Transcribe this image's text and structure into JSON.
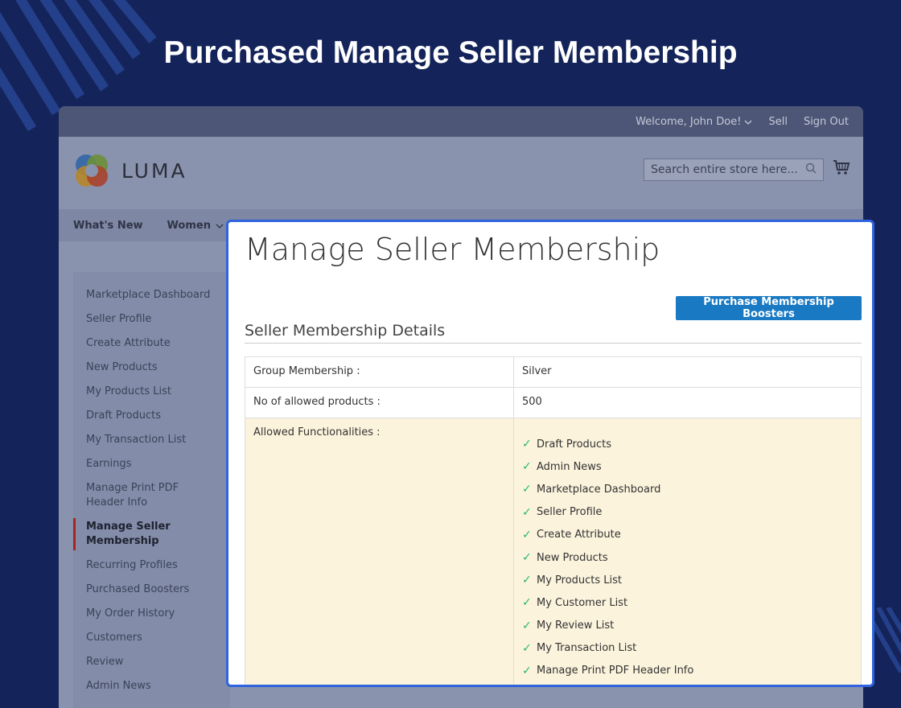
{
  "hero": {
    "title": "Purchased Manage Seller Membership"
  },
  "topbar": {
    "welcome": "Welcome, John Doe!",
    "sell": "Sell",
    "sign_out": "Sign Out"
  },
  "header": {
    "logo_text": "LUMA",
    "search_placeholder": "Search entire store here..."
  },
  "nav": {
    "items": [
      "What's New",
      "Women"
    ]
  },
  "sidebar": {
    "items": [
      "Marketplace Dashboard",
      "Seller Profile",
      "Create Attribute",
      "New Products",
      "My Products List",
      "Draft Products",
      "My Transaction List",
      "Earnings",
      "Manage Print PDF Header Info",
      "Manage Seller Membership",
      "Recurring Profiles",
      "Purchased Boosters",
      "My Order History",
      "Customers",
      "Review",
      "Admin News"
    ],
    "active": "Manage Seller Membership"
  },
  "panel": {
    "title": "Manage Seller Membership",
    "boost_button": "Purchase Membership Boosters",
    "section_title": "Seller Membership Details",
    "rows": [
      {
        "label": "Group Membership :",
        "value": "Silver"
      },
      {
        "label": "No of allowed products :",
        "value": "500"
      }
    ],
    "functionalities_label": "Allowed Functionalities :",
    "functionalities": [
      "Draft Products",
      "Admin News",
      "Marketplace Dashboard",
      "Seller Profile",
      "Create Attribute",
      "New Products",
      "My Products List",
      "My Customer List",
      "My Review List",
      "My Transaction List",
      "Manage Print PDF Header Info"
    ]
  },
  "colors": {
    "background": "#14245a",
    "accent": "#2f63e0",
    "button": "#1979c3",
    "check": "#2bb673",
    "highlight_row": "#fbf3dc"
  }
}
